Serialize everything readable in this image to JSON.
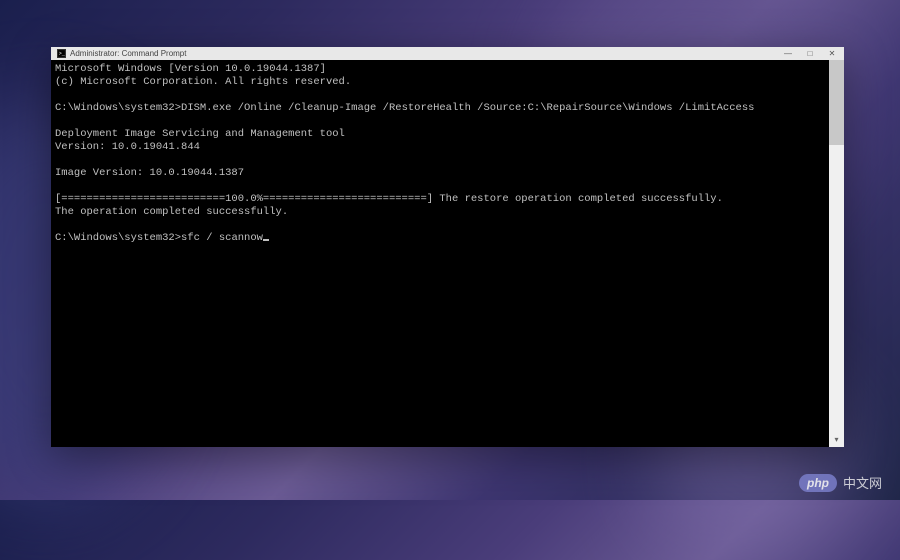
{
  "window": {
    "title": "Administrator: Command Prompt"
  },
  "console": {
    "header1": "Microsoft Windows [Version 10.0.19044.1387]",
    "header2": "(c) Microsoft Corporation. All rights reserved.",
    "prompt1": "C:\\Windows\\system32>",
    "cmd1": "DISM.exe /Online /Cleanup-Image /RestoreHealth /Source:C:\\RepairSource\\Windows /LimitAccess",
    "toolName": "Deployment Image Servicing and Management tool",
    "toolVersion": "Version: 10.0.19041.844",
    "imageVersion": "Image Version: 10.0.19044.1387",
    "progressLine": "[==========================100.0%==========================] The restore operation completed successfully.",
    "completed": "The operation completed successfully.",
    "prompt2": "C:\\Windows\\system32>",
    "cmd2": "sfc / scannow"
  },
  "watermark": {
    "logo": "php",
    "text": "中文网"
  }
}
